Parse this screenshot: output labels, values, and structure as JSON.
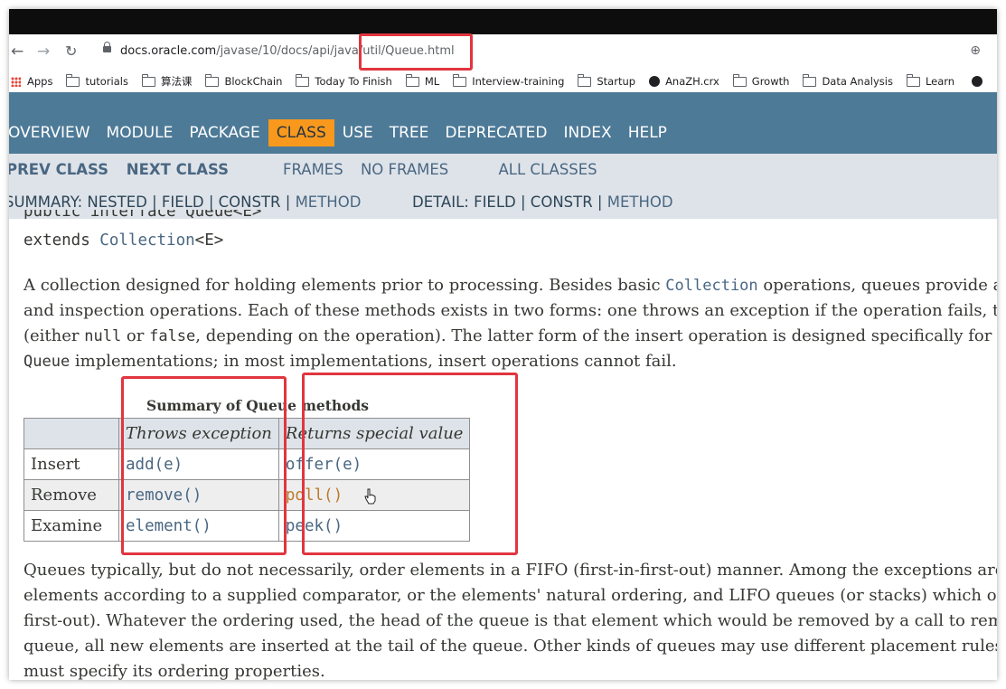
{
  "browser": {
    "url_host": "docs.oracle.com",
    "url_path": "/javase/10/docs/api/java/util/Queue.html",
    "zoom_icon": "zoom-icon",
    "bookmarks": [
      {
        "label": "Apps",
        "icon": "apps-grid-icon"
      },
      {
        "label": "tutorials",
        "icon": "folder-icon"
      },
      {
        "label": "算法课",
        "icon": "folder-icon"
      },
      {
        "label": "BlockChain",
        "icon": "folder-icon"
      },
      {
        "label": "Today To Finish",
        "icon": "folder-icon"
      },
      {
        "label": "ML",
        "icon": "folder-icon"
      },
      {
        "label": "Interview-training",
        "icon": "folder-icon"
      },
      {
        "label": "Startup",
        "icon": "folder-icon"
      },
      {
        "label": "AnaZH.crx",
        "icon": "globe-icon"
      },
      {
        "label": "Growth",
        "icon": "folder-icon"
      },
      {
        "label": "Data Analysis",
        "icon": "folder-icon"
      },
      {
        "label": "Learn",
        "icon": "folder-icon"
      }
    ]
  },
  "javadoc_nav": {
    "items": [
      "OVERVIEW",
      "MODULE",
      "PACKAGE",
      "CLASS",
      "USE",
      "TREE",
      "DEPRECATED",
      "INDEX",
      "HELP"
    ],
    "active": "CLASS",
    "prev_class": "PREV CLASS",
    "next_class": "NEXT CLASS",
    "frames": "FRAMES",
    "no_frames": "NO FRAMES",
    "all_classes": "ALL CLASSES",
    "summary_prefix": "SUMMARY: NESTED | FIELD | CONSTR | ",
    "summary_method": "METHOD",
    "detail_prefix": "DETAIL: FIELD | CONSTR | ",
    "detail_method": "METHOD"
  },
  "content": {
    "signature_partial": "public interface Queue<E>",
    "extends_prefix": "extends ",
    "extends_link": "Collection",
    "extends_suffix": "<E>",
    "intro_lines": [
      [
        "A collection designed for holding elements prior to processing. Besides basic ",
        "Collection",
        " operations, queues provide additional insertion, extraction,"
      ],
      [
        "and inspection operations. Each of these methods exists in two forms: one throws an exception if the operation fails, the other returns a special value"
      ],
      [
        "(either ",
        "null",
        " or ",
        "false",
        ", depending on the operation). The latter form of the insert operation is designed specifically for use with capacity-restricted"
      ],
      [
        "Queue",
        " implementations; in most implementations, insert operations cannot fail."
      ]
    ],
    "table_caption": "Summary of Queue methods",
    "table_headers": [
      "",
      "Throws exception",
      "Returns special value"
    ],
    "table_rows": [
      [
        "Insert",
        "add(e)",
        "offer(e)"
      ],
      [
        "Remove",
        "remove()",
        "poll()"
      ],
      [
        "Examine",
        "element()",
        "peek()"
      ]
    ],
    "outro_lines": [
      "Queues typically, but do not necessarily, order elements in a FIFO (first-in-first-out) manner. Among the exceptions are priority queues, which order",
      "elements according to a supplied comparator, or the elements' natural ordering, and LIFO queues (or stacks) which order the elements LIFO (last-in-",
      "first-out). Whatever the ordering used, the head of the queue is that element which would be removed by a call to remove() or poll(). In a FIFO",
      "queue, all new elements are inserted at the tail of the queue. Other kinds of queues may use different placement rules. Every Queue implementation",
      "must specify its ordering properties."
    ]
  },
  "colors": {
    "nav_bg": "#4d7a97",
    "nav_active": "#f8981d",
    "subnav_bg": "#dee3e9",
    "link": "#4a6782",
    "annotation_red": "#e1353f"
  }
}
